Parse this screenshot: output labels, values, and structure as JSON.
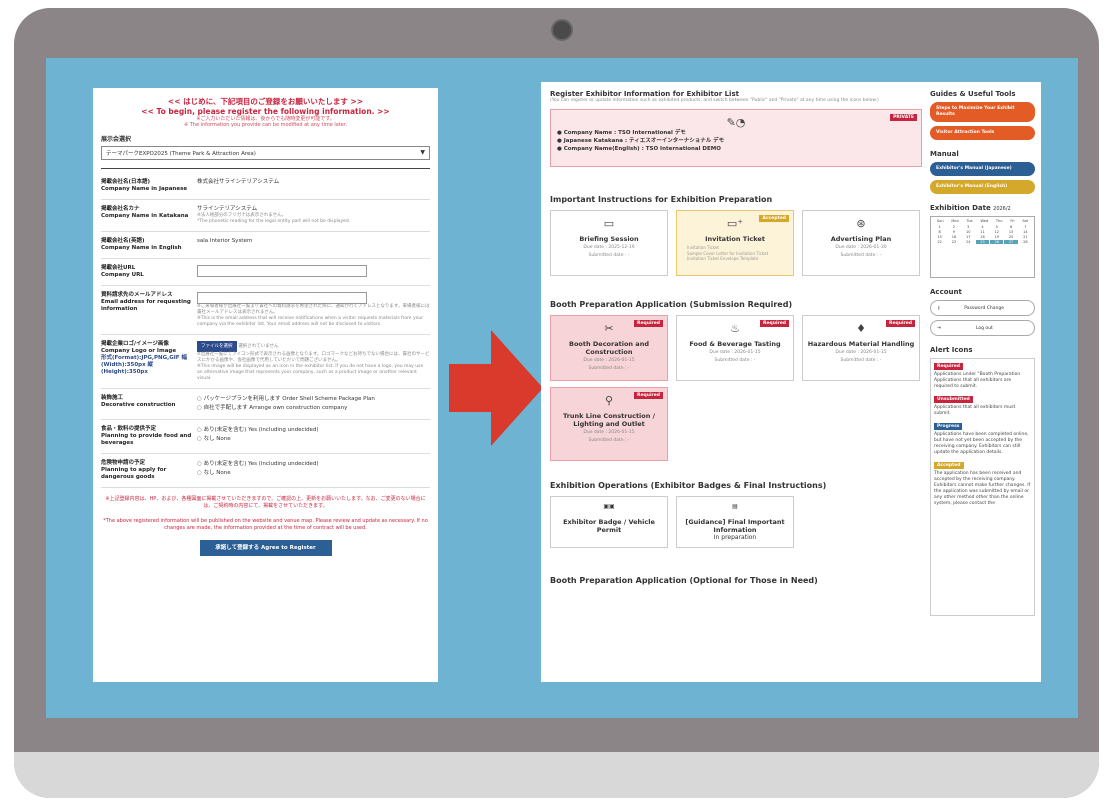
{
  "left_form": {
    "heading_ja": "<< はじめに、下記項目のご登録をお願いいたします >>",
    "heading_en": "<< To begin, please register the following information. >>",
    "note_ja": "※ご入力いただいた情報は、後からでも随時変更が可能です。",
    "note_en": "※ The information you provide can be modified at any time later.",
    "select_label": "展示会選択",
    "select_value": "テーマパークEXPO2025 (Theme Park & Attraction Area)",
    "fields": {
      "company_ja_label": "掲載会社名(日本語)",
      "company_ja_label_en": "Company Name in Japanese",
      "company_ja_value": "株式会社サラインテリアシステム",
      "company_kana_label": "掲載会社名カナ",
      "company_kana_label_en": "Company Name in Katakana",
      "company_kana_value": "サラインテリアシステム",
      "company_kana_note_ja": "※法人格部分のフリガナは表示されません。",
      "company_kana_note_en": "*The phonetic reading for the legal entity part will not be displayed.",
      "company_en_label": "掲載会社名(英語)",
      "company_en_label_en": "Company Name in English",
      "company_en_value": "sala Interior System",
      "url_label": "掲載会社URL",
      "url_label_en": "Company URL",
      "email_label": "資料請求先のメールアドレス",
      "email_label_en": "Email address for requesting information",
      "email_note_ja": "※ご来場者様が出展社一覧より貴社への資料請求を希望された際に、通知が行くアドレスとなります。来場者様には貴社メールアドレスは表示されません。",
      "email_note_en": "※This is the email address that will receive notifications when a visitor requests materials from your company via the exhibitor list. Your email address will not be disclosed to visitors.",
      "logo_label": "掲載企業ロゴ/イメージ画像",
      "logo_label_en": "Company Logo or Image",
      "logo_format": "形式(Format):JPG,PNG,GIF 幅(Width):350px 縦(Height):350px",
      "file_button": "ファイルを選択",
      "file_none": "選択されていません",
      "logo_note_ja": "※出展社一覧にてアイコン形式で表示される画像となります。ロゴマークなどお持ちでない場合には、貴社のサービスにかかる画像や、会社画像で代用していただいて問題ございません。",
      "logo_note_en": "※This image will be displayed as an icon in the exhibitor list. If you do not have a logo, you may use an alternative image that represents your company, such as a product image or another relevant visual.",
      "decor_label": "装飾施工",
      "decor_label_en": "Decorative construction",
      "decor_opt1": "パッケージプランを利用します Order Shell Scheme Package Plan",
      "decor_opt2": "自社で手配します Arrange own construction company",
      "food_label": "食品・飲料の提供予定",
      "food_label_en": "Planning to provide food and beverages",
      "food_opt1": "あり(未定を含む) Yes (including undecided)",
      "food_opt2": "なし None",
      "danger_label": "危険物申請の予定",
      "danger_label_en": "Planning to apply for dangerous goods",
      "danger_opt1": "あり(未定を含む) Yes (including undecided)",
      "danger_opt2": "なし None"
    },
    "footer_ja": "※上記登録内容は、HP、および、各種図面に掲載させていただきますので、ご確認の上、更新をお願いいたします。なお、ご変更のない場合には、ご契約時の内容にて、掲載をさせていただきます。",
    "footer_en": "*The above registered information will be published on the website and venue map. Please review and update as necessary. If no changes are made, the information provided at the time of contract will be used.",
    "agree_button": "承諾して登録する Agree to Register"
  },
  "right_panel": {
    "register_title": "Register Exhibitor Information for Exhibitor List",
    "register_sub": "(You can register or update information such as exhibited products, and switch between \"Public\" and \"Private\" at any time using the icons below.)",
    "private_badge": "PRIVATE",
    "company_name": "● Company Name : TSO International デモ",
    "company_kana": "● Japanese Katakana : ティエスオーインターナショナル デモ",
    "company_en": "● Company Name(English) : TSO International DEMO",
    "important_heading": "Important Instructions for Exhibition Preparation",
    "important_cards": [
      {
        "title": "Briefing Session",
        "due": "Due date : 2025-12-19",
        "submitted": "Submitted date : -",
        "badge": ""
      },
      {
        "title": "Invitation Ticket",
        "due": "",
        "submitted": "",
        "badge": "Accepted",
        "notes": [
          "Invitation Ticket",
          "Sample Cover Letter for Invitation Ticket",
          "Invitation Ticket Envelope Template"
        ]
      },
      {
        "title": "Advertising Plan",
        "due": "Due date : 2026-01-30",
        "submitted": "Submitted date : -",
        "badge": ""
      }
    ],
    "booth_required_heading": "Booth Preparation Application (Submission Required)",
    "booth_required_cards": [
      {
        "title": "Booth Decoration and Construction",
        "due": "Due date : 2026-01-15",
        "submitted": "Submitted date : -",
        "badge": "Required"
      },
      {
        "title": "Food & Beverage Tasting",
        "due": "Due date : 2026-01-15",
        "submitted": "Submitted date : -",
        "badge": "Required"
      },
      {
        "title": "Hazardous Material Handling",
        "due": "Due date : 2026-01-15",
        "submitted": "Submitted date : -",
        "badge": "Required"
      },
      {
        "title": "Trunk Line Construction / Lighting and Outlet",
        "due": "Due date : 2026-01-15",
        "submitted": "Submitted date : -",
        "badge": "Required"
      }
    ],
    "operations_heading": "Exhibition Operations (Exhibitor Badges & Final Instructions)",
    "operations_cards": [
      {
        "title": "Exhibitor Badge / Vehicle Permit",
        "sub": ""
      },
      {
        "title": "[Guidance] Final Important Information",
        "sub": "In preparation"
      }
    ],
    "optional_heading": "Booth Preparation Application (Optional for Those in Need)",
    "sidebar": {
      "tools_heading": "Guides & Useful Tools",
      "tool1": "Steps to Maximize Your Exhibit Results",
      "tool2": "Visitor Attraction Tools",
      "manual_heading": "Manual",
      "manual1": "Exhibitor's Manual (Japanese)",
      "manual2": "Exhibitor's Manual (English)",
      "date_heading": "Exhibition Date",
      "date_year": "2026/2",
      "cal_days": [
        "Sun",
        "Mon",
        "Tue",
        "Wed",
        "Thu",
        "Fri",
        "Sat"
      ],
      "cal_dates": [
        "1",
        "2",
        "3",
        "4",
        "5",
        "6",
        "7",
        "8",
        "9",
        "10",
        "11",
        "12",
        "13",
        "14",
        "15",
        "16",
        "17",
        "18",
        "19",
        "20",
        "21",
        "22",
        "23",
        "24",
        "25",
        "26",
        "27",
        "28"
      ],
      "account_heading": "Account",
      "password_btn": "Password Change",
      "logout_btn": "Log out",
      "alert_heading": "Alert Icons",
      "alert_required": "Required",
      "alert_required_txt": "Applications under \"Booth Preparation Applications that all exhibitors are required to submit.",
      "alert_unsubmitted": "Unsubmitted",
      "alert_unsubmitted_txt": "Applications that all exhibitors must submit.",
      "alert_progress": "Progress",
      "alert_progress_txt": "Applications have been completed online, but have not yet been accepted by the receiving company. Exhibitors can still update the application details.",
      "alert_accepted": "Accepted",
      "alert_accepted_txt": "The application has been received and accepted by the receiving company. Exhibitors cannot make further changes. If the application was submitted by email or any other method other than the online system, please contact the"
    }
  },
  "colors": {
    "accent_red": "#c7253e",
    "navy": "#2c5f94",
    "orange": "#e35c26",
    "gold": "#d4a82a",
    "screen_bg": "#6fb3d3"
  }
}
